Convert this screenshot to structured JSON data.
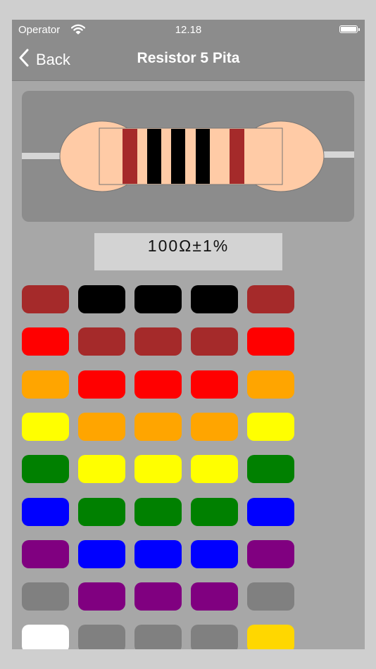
{
  "status_bar": {
    "carrier": "Operator",
    "time": "12.18"
  },
  "nav": {
    "back_label": "Back",
    "title": "Resistor 5 Pita"
  },
  "resistor": {
    "body_color": "#ffcba6",
    "lead_color": "#d6d6d6",
    "band_colors": [
      "#a52a2a",
      "#000000",
      "#000000",
      "#000000",
      "#a52a2a"
    ]
  },
  "readout": {
    "value": "100Ω±1%"
  },
  "color_columns": [
    [
      "#a52a2a",
      "#ff0000",
      "#ffa500",
      "#ffff00",
      "#008000",
      "#0000ff",
      "#800080",
      "#808080",
      "#ffffff"
    ],
    [
      "#000000",
      "#a52a2a",
      "#ff0000",
      "#ffa500",
      "#ffff00",
      "#008000",
      "#0000ff",
      "#800080",
      "#808080"
    ],
    [
      "#000000",
      "#a52a2a",
      "#ff0000",
      "#ffa500",
      "#ffff00",
      "#008000",
      "#0000ff",
      "#800080",
      "#808080"
    ],
    [
      "#000000",
      "#a52a2a",
      "#ff0000",
      "#ffa500",
      "#ffff00",
      "#008000",
      "#0000ff",
      "#800080",
      "#808080"
    ],
    [
      "#a52a2a",
      "#ff0000",
      "#ffa500",
      "#ffff00",
      "#008000",
      "#0000ff",
      "#800080",
      "#808080",
      "#ffd700"
    ]
  ]
}
